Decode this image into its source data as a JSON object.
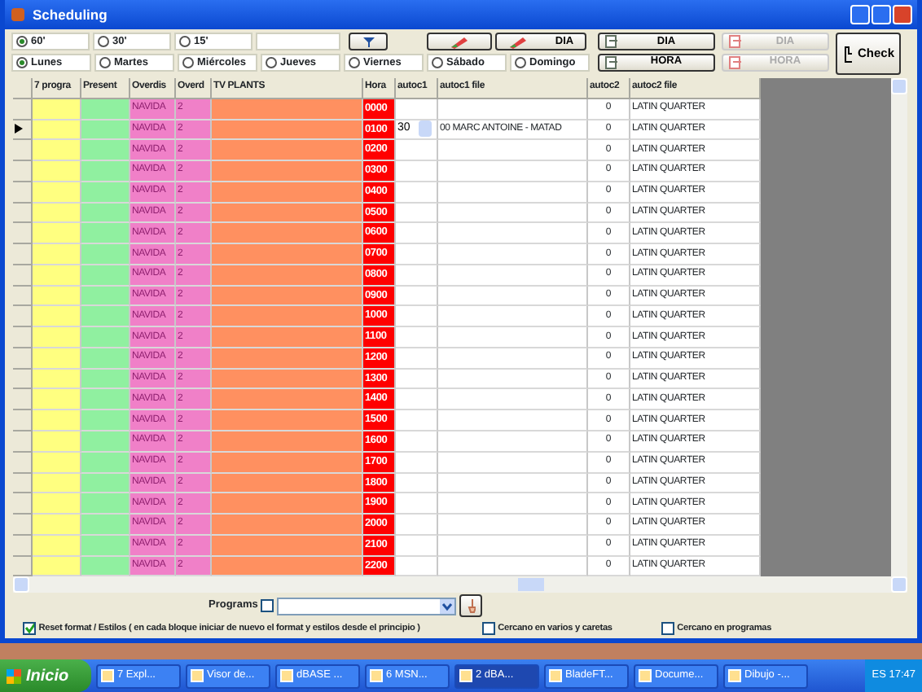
{
  "window": {
    "title": "Scheduling"
  },
  "interval_options": [
    {
      "label": "60'",
      "selected": true
    },
    {
      "label": "30'",
      "selected": false
    },
    {
      "label": "15'",
      "selected": false
    }
  ],
  "day_options": [
    {
      "label": "Lunes",
      "selected": true
    },
    {
      "label": "Martes",
      "selected": false
    },
    {
      "label": "Miércoles",
      "selected": false
    },
    {
      "label": "Jueves",
      "selected": false
    },
    {
      "label": "Viernes",
      "selected": false
    },
    {
      "label": "Sábado",
      "selected": false
    },
    {
      "label": "Domingo",
      "selected": false
    }
  ],
  "edit_buttons": [
    {
      "label": "DIA"
    }
  ],
  "copy_buttons": [
    {
      "label": "DIA",
      "disabled": false
    },
    {
      "label": "HORA",
      "disabled": false
    }
  ],
  "paste_buttons": [
    {
      "label": "DIA",
      "disabled": true
    },
    {
      "label": "HORA",
      "disabled": true
    }
  ],
  "check_button": {
    "label": "Check"
  },
  "columns": [
    "7 progra",
    "Present",
    "Overdis",
    "Overd",
    "TV PLANTS",
    "Hora",
    "autoc1",
    "autoc1 file",
    "autoc2",
    "autoc2 file"
  ],
  "rows": [
    {
      "current": false,
      "cells": [
        "",
        "",
        "NAVIDA",
        "2",
        "",
        "0000",
        "",
        "",
        "0",
        "LATIN QUARTER"
      ]
    },
    {
      "current": true,
      "editing": true,
      "cells": [
        "",
        "",
        "NAVIDA",
        "2",
        "",
        "0100",
        "30",
        "00 MARC ANTOINE - MATAD",
        "0",
        "LATIN QUARTER"
      ]
    },
    {
      "current": false,
      "cells": [
        "",
        "",
        "NAVIDA",
        "2",
        "",
        "0200",
        "",
        "",
        "0",
        "LATIN QUARTER"
      ]
    },
    {
      "current": false,
      "cells": [
        "",
        "",
        "NAVIDA",
        "2",
        "",
        "0300",
        "",
        "",
        "0",
        "LATIN QUARTER"
      ]
    },
    {
      "current": false,
      "cells": [
        "",
        "",
        "NAVIDA",
        "2",
        "",
        "0400",
        "",
        "",
        "0",
        "LATIN QUARTER"
      ]
    },
    {
      "current": false,
      "cells": [
        "",
        "",
        "NAVIDA",
        "2",
        "",
        "0500",
        "",
        "",
        "0",
        "LATIN QUARTER"
      ]
    },
    {
      "current": false,
      "cells": [
        "",
        "",
        "NAVIDA",
        "2",
        "",
        "0600",
        "",
        "",
        "0",
        "LATIN QUARTER"
      ]
    },
    {
      "current": false,
      "cells": [
        "",
        "",
        "NAVIDA",
        "2",
        "",
        "0700",
        "",
        "",
        "0",
        "LATIN QUARTER"
      ]
    },
    {
      "current": false,
      "cells": [
        "",
        "",
        "NAVIDA",
        "2",
        "",
        "0800",
        "",
        "",
        "0",
        "LATIN QUARTER"
      ]
    },
    {
      "current": false,
      "cells": [
        "",
        "",
        "NAVIDA",
        "2",
        "",
        "0900",
        "",
        "",
        "0",
        "LATIN QUARTER"
      ]
    },
    {
      "current": false,
      "cells": [
        "",
        "",
        "NAVIDA",
        "2",
        "",
        "1000",
        "",
        "",
        "0",
        "LATIN QUARTER"
      ]
    },
    {
      "current": false,
      "cells": [
        "",
        "",
        "NAVIDA",
        "2",
        "",
        "1100",
        "",
        "",
        "0",
        "LATIN QUARTER"
      ]
    },
    {
      "current": false,
      "cells": [
        "",
        "",
        "NAVIDA",
        "2",
        "",
        "1200",
        "",
        "",
        "0",
        "LATIN QUARTER"
      ]
    },
    {
      "current": false,
      "cells": [
        "",
        "",
        "NAVIDA",
        "2",
        "",
        "1300",
        "",
        "",
        "0",
        "LATIN QUARTER"
      ]
    },
    {
      "current": false,
      "cells": [
        "",
        "",
        "NAVIDA",
        "2",
        "",
        "1400",
        "",
        "",
        "0",
        "LATIN QUARTER"
      ]
    },
    {
      "current": false,
      "cells": [
        "",
        "",
        "NAVIDA",
        "2",
        "",
        "1500",
        "",
        "",
        "0",
        "LATIN QUARTER"
      ]
    },
    {
      "current": false,
      "cells": [
        "",
        "",
        "NAVIDA",
        "2",
        "",
        "1600",
        "",
        "",
        "0",
        "LATIN QUARTER"
      ]
    },
    {
      "current": false,
      "cells": [
        "",
        "",
        "NAVIDA",
        "2",
        "",
        "1700",
        "",
        "",
        "0",
        "LATIN QUARTER"
      ]
    },
    {
      "current": false,
      "cells": [
        "",
        "",
        "NAVIDA",
        "2",
        "",
        "1800",
        "",
        "",
        "0",
        "LATIN QUARTER"
      ]
    },
    {
      "current": false,
      "cells": [
        "",
        "",
        "NAVIDA",
        "2",
        "",
        "1900",
        "",
        "",
        "0",
        "LATIN QUARTER"
      ]
    },
    {
      "current": false,
      "cells": [
        "",
        "",
        "NAVIDA",
        "2",
        "",
        "2000",
        "",
        "",
        "0",
        "LATIN QUARTER"
      ]
    },
    {
      "current": false,
      "cells": [
        "",
        "",
        "NAVIDA",
        "2",
        "",
        "2100",
        "",
        "",
        "0",
        "LATIN QUARTER"
      ]
    },
    {
      "current": false,
      "cells": [
        "",
        "",
        "NAVIDA",
        "2",
        "",
        "2200",
        "",
        "",
        "0",
        "LATIN QUARTER"
      ]
    }
  ],
  "programs": {
    "label": "Programs",
    "checked": false
  },
  "options": [
    {
      "label": "Reset format / Estilos ( en cada bloque iniciar de nuevo el format y estilos desde el principio )",
      "checked": true
    },
    {
      "label": "Cercano en varios y caretas",
      "checked": false
    },
    {
      "label": "Cercano en programas",
      "checked": false
    }
  ],
  "taskbar": {
    "start": "Inicio",
    "items": [
      "7 Expl...",
      "Visor de...",
      "dBASE ...",
      "6 MSN...",
      "2 dBA...",
      "BladeFT...",
      "Docume...",
      "Dibujo -..."
    ],
    "language": "ES",
    "clock": "17:47"
  }
}
